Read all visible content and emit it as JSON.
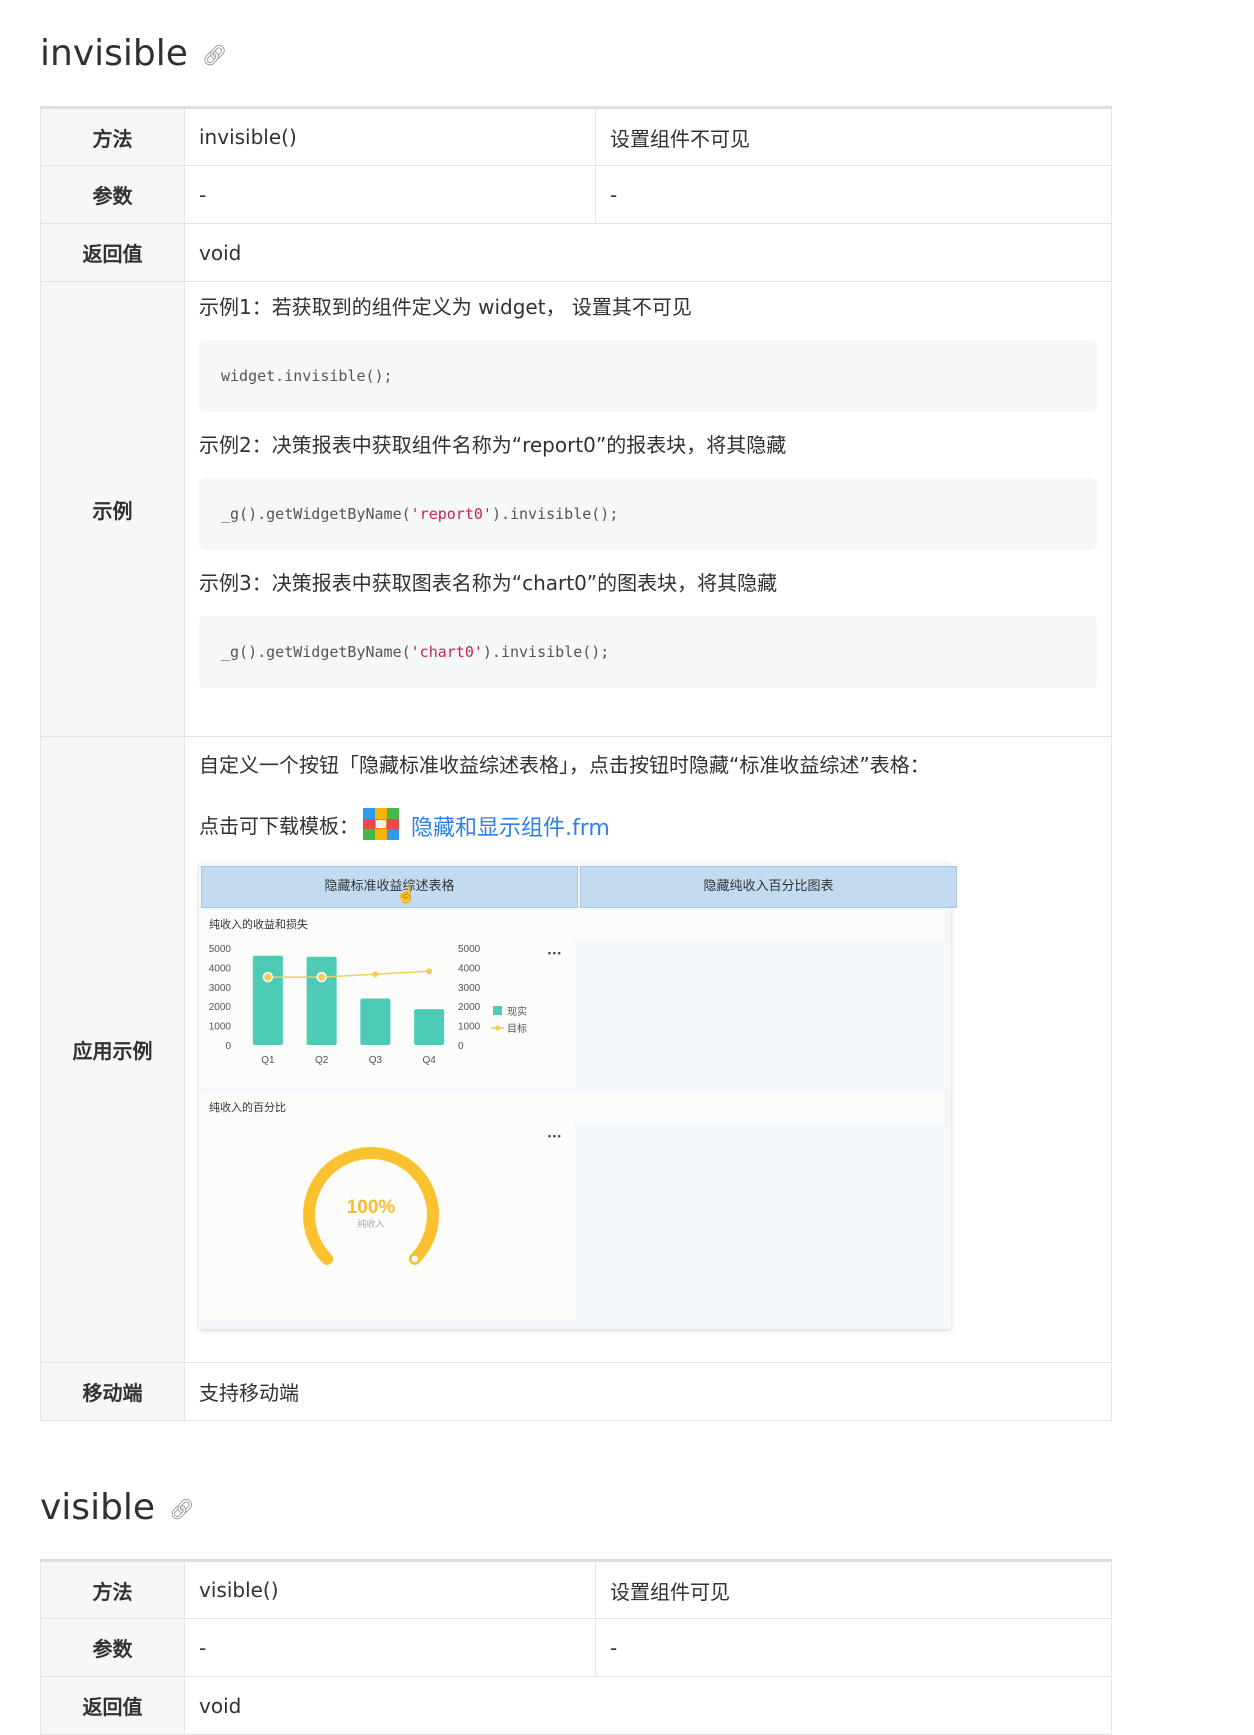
{
  "sections": {
    "invisible": {
      "heading": "invisible",
      "method_label": "方法",
      "method_value": "invisible()",
      "method_desc": "设置组件不可见",
      "params_label": "参数",
      "params_value": "-",
      "params_desc": "-",
      "return_label": "返回值",
      "return_value": "void",
      "example_label": "示例",
      "examples": [
        {
          "text": "示例1：若获取到的组件定义为 widget， 设置其不可见",
          "code_prefix": "widget.invisible();",
          "code_str": "",
          "code_suffix": ""
        },
        {
          "text": "示例2：决策报表中获取组件名称为“report0”的报表块，将其隐藏",
          "code_prefix": "_g().getWidgetByName(",
          "code_str": "'report0'",
          "code_suffix": ").invisible();"
        },
        {
          "text": "示例3：决策报表中获取图表名称为“chart0”的图表块，将其隐藏",
          "code_prefix": "_g().getWidgetByName(",
          "code_str": "'chart0'",
          "code_suffix": ").invisible();"
        }
      ],
      "app_label": "应用示例",
      "app_desc": "自定义一个按钮「隐藏标准收益综述表格」，点击按钮时隐藏“标准收益综述”表格：",
      "download_prefix": "点击可下载模板：",
      "download_link": "隐藏和显示组件.frm",
      "mobile_label": "移动端",
      "mobile_value": "支持移动端"
    },
    "visible": {
      "heading": "visible",
      "method_label": "方法",
      "method_value": "visible()",
      "method_desc": "设置组件可见",
      "params_label": "参数",
      "params_value": "-",
      "params_desc": "-",
      "return_label": "返回值",
      "return_value": "void"
    }
  },
  "screenshot": {
    "button_hide_table": "隐藏标准收益综述表格",
    "button_hide_chart": "隐藏纯收入百分比图表",
    "panel1_title": "纯收入的收益和损失",
    "panel2_title": "纯收入的百分比",
    "more_icon": "···",
    "gauge_value": "100%",
    "gauge_label": "纯收入"
  },
  "chart_data": [
    {
      "type": "bar",
      "title": "纯收入的收益和损失",
      "categories": [
        "Q1",
        "Q2",
        "Q3",
        "Q4"
      ],
      "y_ticks": [
        "5000",
        "4000",
        "3000",
        "2000",
        "1000",
        "0"
      ],
      "ylim": [
        0,
        5000
      ],
      "series": [
        {
          "name": "现实",
          "type": "bar",
          "color": "#4dcbb5",
          "values": [
            4600,
            4550,
            2400,
            1850
          ]
        },
        {
          "name": "目标",
          "type": "line",
          "color": "#f4cd5b",
          "values": [
            3500,
            3500,
            3650,
            3800
          ]
        }
      ],
      "legend_position": "right"
    },
    {
      "type": "gauge",
      "title": "纯收入的百分比",
      "value": 100,
      "value_label": "100%",
      "label": "纯收入",
      "color": "#fbc12f"
    }
  ]
}
